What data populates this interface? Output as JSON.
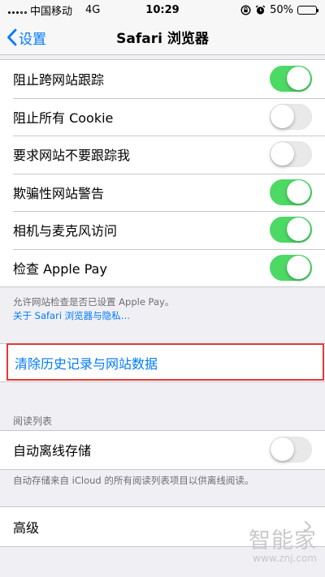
{
  "status_bar": {
    "carrier": "中国移动",
    "network": "4G",
    "time": "10:29",
    "battery": "50%"
  },
  "nav": {
    "back_label": "设置",
    "title": "Safari 浏览器"
  },
  "privacy": {
    "items": [
      {
        "label": "阻止跨网站跟踪",
        "on": true
      },
      {
        "label": "阻止所有 Cookie",
        "on": false
      },
      {
        "label": "要求网站不要跟踪我",
        "on": false
      },
      {
        "label": "欺骗性网站警告",
        "on": true
      },
      {
        "label": "相机与麦克风访问",
        "on": true
      },
      {
        "label": "检查 Apple Pay",
        "on": true
      }
    ],
    "footer_text": "允许网站检查是否已设置 Apple Pay。",
    "footer_link": "关于 Safari 浏览器与隐私…"
  },
  "clear_history": {
    "label": "清除历史记录与网站数据"
  },
  "reading_list": {
    "header": "阅读列表",
    "item": {
      "label": "自动离线存储",
      "on": false
    },
    "footer_text": "自动存储来自 iCloud 的所有阅读列表项目以供离线阅读。"
  },
  "advanced": {
    "label": "高级"
  },
  "watermark": {
    "main": "智能家",
    "url": "www.znj.com"
  },
  "colors": {
    "accent": "#007aff",
    "toggle_on": "#4cd964",
    "highlight": "#e53935"
  }
}
